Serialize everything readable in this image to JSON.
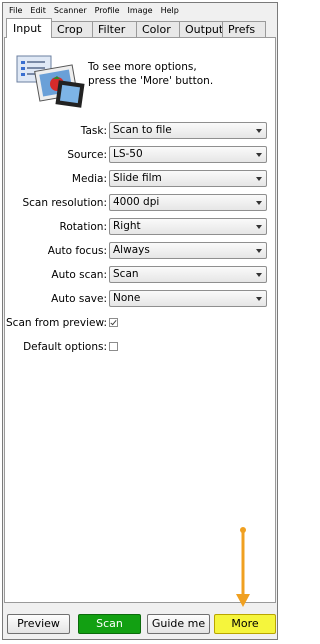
{
  "menu": [
    "File",
    "Edit",
    "Scanner",
    "Profile",
    "Image",
    "Help"
  ],
  "tabs": [
    "Input",
    "Crop",
    "Filter",
    "Color",
    "Output",
    "Prefs"
  ],
  "active_tab": "Input",
  "hint": {
    "line1": "To see more options,",
    "line2": "press the 'More' button."
  },
  "fields": [
    {
      "label": "Task:",
      "value": "Scan to file"
    },
    {
      "label": "Source:",
      "value": "LS-50"
    },
    {
      "label": "Media:",
      "value": "Slide film"
    },
    {
      "label": "Scan resolution:",
      "value": "4000 dpi"
    },
    {
      "label": "Rotation:",
      "value": "Right"
    },
    {
      "label": "Auto focus:",
      "value": "Always"
    },
    {
      "label": "Auto scan:",
      "value": "Scan"
    },
    {
      "label": "Auto save:",
      "value": "None"
    }
  ],
  "checkboxes": [
    {
      "label": "Scan from preview:",
      "checked": true
    },
    {
      "label": "Default options:",
      "checked": false
    }
  ],
  "buttons": {
    "preview": "Preview",
    "scan": "Scan",
    "guide": "Guide me",
    "more": "More"
  },
  "colors": {
    "scan_button": "#12a012",
    "more_button": "#f5f53c",
    "annotation_arrow": "#f0a020"
  },
  "icons": {
    "hint": "photo-film-icon",
    "annotation": "down-arrow-icon"
  }
}
